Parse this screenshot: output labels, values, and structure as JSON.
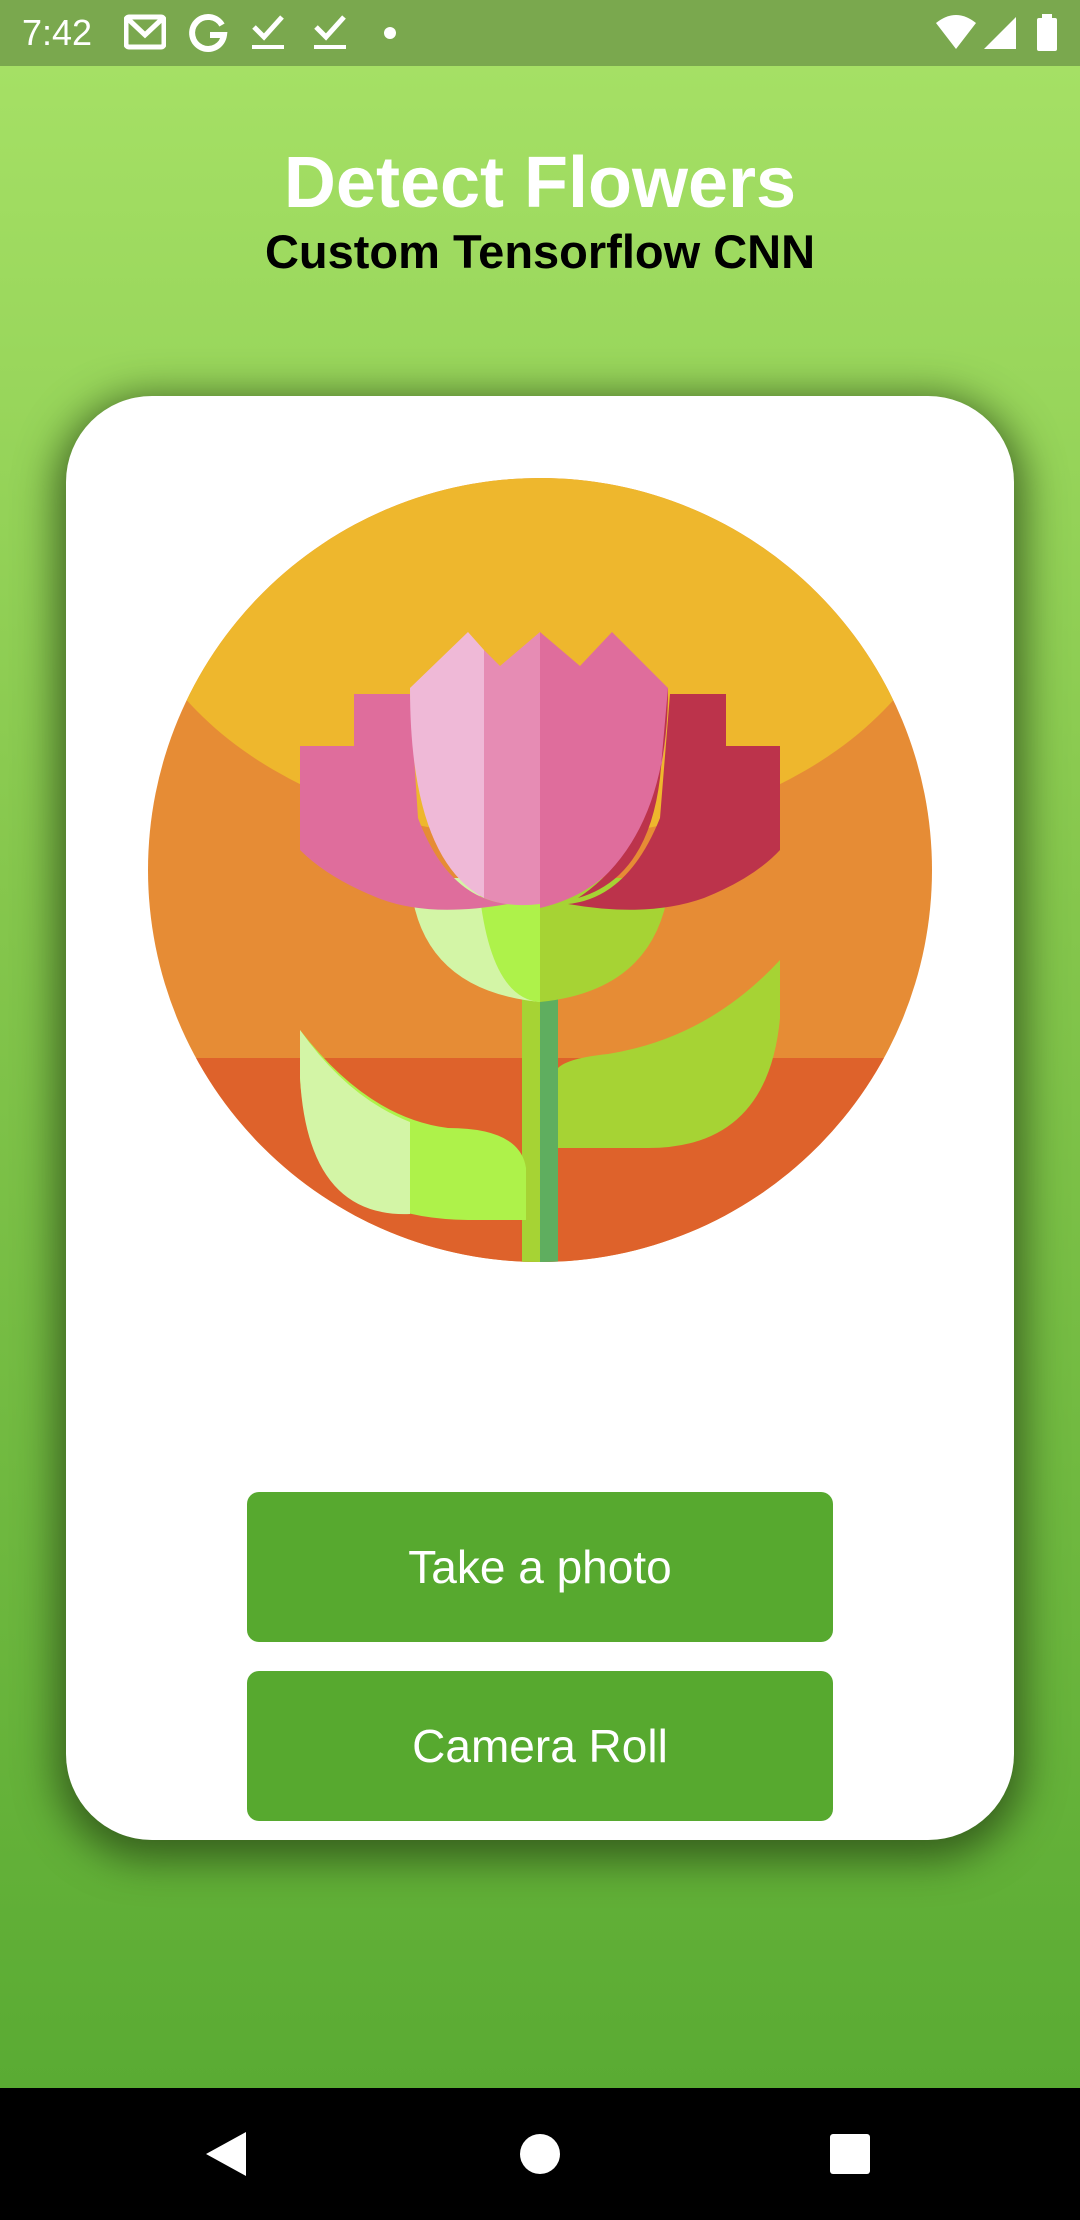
{
  "status_bar": {
    "time": "7:42",
    "icons": [
      "gmail-icon",
      "google-icon",
      "check-icon",
      "check-icon",
      "dot-icon",
      "wifi-icon",
      "signal-icon",
      "battery-icon"
    ]
  },
  "header": {
    "title": "Detect Flowers",
    "subtitle": "Custom Tensorflow CNN"
  },
  "card": {
    "image": "tulip-flower-illustration",
    "buttons": {
      "take_photo": "Take a photo",
      "camera_roll": "Camera Roll"
    }
  },
  "nav_bar": {
    "icons": [
      "back-icon",
      "home-icon",
      "recents-icon"
    ]
  },
  "colors": {
    "status_bar": "#7aa84e",
    "gradient_top": "#a5e065",
    "gradient_bottom": "#5aab33",
    "button": "#57a92f",
    "card": "#ffffff"
  }
}
